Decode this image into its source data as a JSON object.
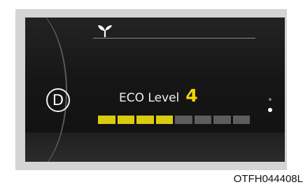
{
  "gear": {
    "label": "D"
  },
  "eco": {
    "label": "ECO Level",
    "value": "4",
    "level": 4,
    "max_level": 8
  },
  "page_indicator": {
    "pages": 2,
    "active_page": 2
  },
  "figure_code": "OTFH044408L",
  "colors": {
    "active_segment": "#d9cc0f",
    "inactive_segment": "#5d5d5d",
    "level_number": "#f4d600"
  },
  "icons": {
    "eco": "sprout-icon"
  }
}
